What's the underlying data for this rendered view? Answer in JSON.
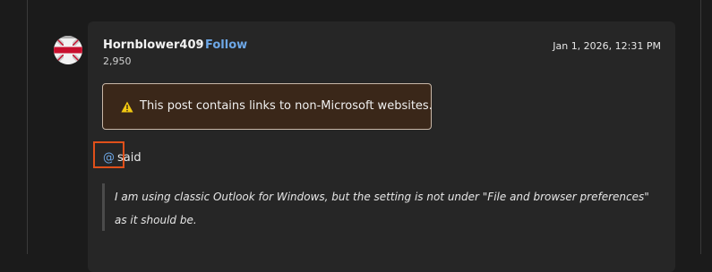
{
  "post": {
    "author": {
      "username": "Hornblower409",
      "separator": "•",
      "follow_label": "Follow",
      "points": "2,950",
      "avatar_icon": "union-jack-avatar"
    },
    "timestamp": "Jan 1, 2026, 12:31 PM",
    "warning": {
      "icon": "warning-triangle-icon",
      "text": "This post contains links to non-Microsoft websites."
    },
    "mention": {
      "symbol": "@",
      "said": "said"
    },
    "quote": {
      "line1": "I am using classic Outlook for Windows, but the setting is not under \"File and browser preferences\"",
      "line2": "as it should be."
    }
  },
  "colors": {
    "background": "#1b1b1b",
    "card": "#262626",
    "link": "#6da7e6",
    "warning_bg": "#3a2719",
    "warning_icon": "#f2c811",
    "highlight": "#e0501a"
  }
}
